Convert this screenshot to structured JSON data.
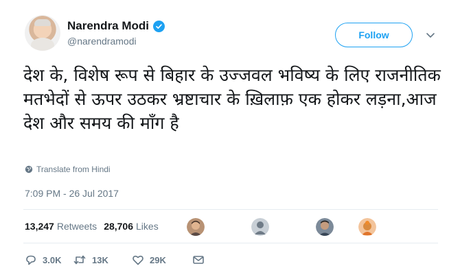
{
  "author": {
    "name": "Narendra Modi",
    "handle": "@narendramodi",
    "verified": true
  },
  "follow_label": "Follow",
  "tweet_text": "देश के, विशेष रूप से बिहार के उज्जवल भविष्य के लिए राजनीतिक मतभेदों से ऊपर उठकर भ्रष्टाचार के ख़िलाफ़ एक होकर लड़ना,आज देश और समय की माँग है",
  "translate_label": "Translate from Hindi",
  "timestamp": "7:09 PM - 26 Jul 2017",
  "stats": {
    "retweets_count": "13,247",
    "retweets_label": "Retweets",
    "likes_count": "28,706",
    "likes_label": "Likes"
  },
  "actions": {
    "reply_count": "3.0K",
    "retweet_count": "13K",
    "like_count": "29K"
  },
  "colors": {
    "accent": "#1da1f2",
    "text_secondary": "#657786",
    "divider": "#e6ecf0"
  },
  "icons": [
    "verified-icon",
    "chevron-down-icon",
    "globe-icon",
    "reply-icon",
    "retweet-icon",
    "like-icon",
    "message-icon"
  ]
}
